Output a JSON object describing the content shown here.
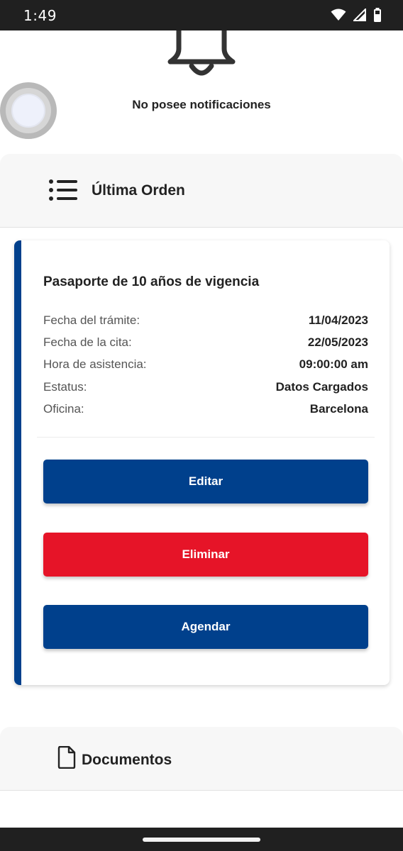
{
  "status_bar": {
    "time": "1:49",
    "icons": [
      "wifi-icon",
      "signal-icon",
      "battery-icon"
    ]
  },
  "notifications": {
    "icon": "bell-icon",
    "empty_text": "No posee notificaciones"
  },
  "last_order": {
    "header_icon": "list-icon",
    "header_title": "Última Orden",
    "card": {
      "title": "Pasaporte de 10 años de vigencia",
      "rows": [
        {
          "label": "Fecha del trámite:",
          "value": "11/04/2023"
        },
        {
          "label": "Fecha de la cita:",
          "value": "22/05/2023"
        },
        {
          "label": "Hora de asistencia:",
          "value": "09:00:00 am"
        },
        {
          "label": "Estatus:",
          "value": "Datos Cargados"
        },
        {
          "label": "Oficina:",
          "value": "Barcelona"
        }
      ],
      "buttons": {
        "edit": "Editar",
        "delete": "Eliminar",
        "schedule": "Agendar"
      }
    }
  },
  "documents": {
    "header_icon": "document-icon",
    "header_title": "Documentos"
  },
  "colors": {
    "primary_blue": "#00408c",
    "danger_red": "#e61428"
  }
}
